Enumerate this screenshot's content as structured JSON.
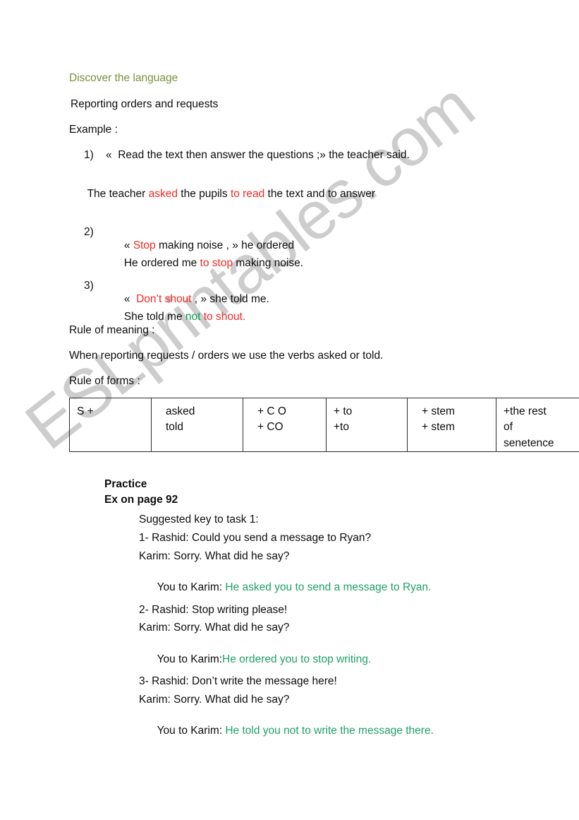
{
  "document": {
    "section_heading": "Discover the language",
    "subtitle": "Reporting orders and requests",
    "example_label": "Example :",
    "examples": [
      {
        "number": "1)",
        "quote_pre": "«  Read the text then answer the questions ;» the teacher said.",
        "answer_parts": [
          {
            "text": "The teacher ",
            "color": "black"
          },
          {
            "text": "asked",
            "color": "red"
          },
          {
            "text": " the pupils ",
            "color": "black"
          },
          {
            "text": "to read",
            "color": "red"
          },
          {
            "text": " the text and to answer",
            "color": "black"
          }
        ]
      },
      {
        "number": "2)",
        "quote_parts": [
          {
            "text": "« ",
            "color": "black"
          },
          {
            "text": "Stop",
            "color": "red"
          },
          {
            "text": " making noise , » he ordered",
            "color": "black"
          }
        ],
        "answer_parts": [
          {
            "text": "He ordered me ",
            "color": "black"
          },
          {
            "text": "to stop",
            "color": "red"
          },
          {
            "text": " making noise.",
            "color": "black"
          }
        ]
      },
      {
        "number": "3)",
        "quote_parts": [
          {
            "text": "«  ",
            "color": "black"
          },
          {
            "text": "Don’t shout",
            "color": "red"
          },
          {
            "text": " , » she told me.",
            "color": "black"
          }
        ],
        "answer_parts": [
          {
            "text": "She told me ",
            "color": "black"
          },
          {
            "text": "not",
            "color": "green"
          },
          {
            "text": " ",
            "color": "black"
          },
          {
            "text": "to shout.",
            "color": "red"
          }
        ]
      }
    ],
    "rule_meaning_label": "Rule of meaning :",
    "rule_meaning_text": "When reporting requests / orders we use the verbs asked or told.",
    "rule_forms_label": "Rule of forms :",
    "rule_table": {
      "columns": 6,
      "rows": [
        [
          "S +",
          "asked\ntold",
          "+ C O\n+ CO",
          "+ to\n+to",
          "+ stem\n+  stem",
          "+the rest\nof\nsenetence"
        ]
      ]
    },
    "practice": {
      "title": "Practice",
      "exercise": "Ex on page 92",
      "key_label": "Suggested key to task 1:",
      "items": [
        {
          "prompt": "1- Rashid: Could you send a message to Ryan?",
          "reply": "Karim: Sorry. What did he say?",
          "answer_label": "You to Karim: ",
          "answer_text": "He asked you to send a message to Ryan."
        },
        {
          "prompt": "2- Rashid: Stop writing please!",
          "reply": "Karim: Sorry. What did he say?",
          "answer_label": "You to Karim:",
          "answer_text": "He ordered you to stop writing."
        },
        {
          "prompt": "3- Rashid: Don’t write the message here!",
          "reply": "Karim: Sorry. What did he say?",
          "answer_label": "You to Karim: ",
          "answer_text": "He told you not to write the message there."
        }
      ]
    }
  },
  "watermark": {
    "text": "ESLprintables.com",
    "color": "#cdcdcd"
  },
  "colors": {
    "heading_green": "#77923c",
    "accent_red": "#ee2a24",
    "answer_green": "#1fa06a",
    "body_black": "#0d0d0d"
  }
}
